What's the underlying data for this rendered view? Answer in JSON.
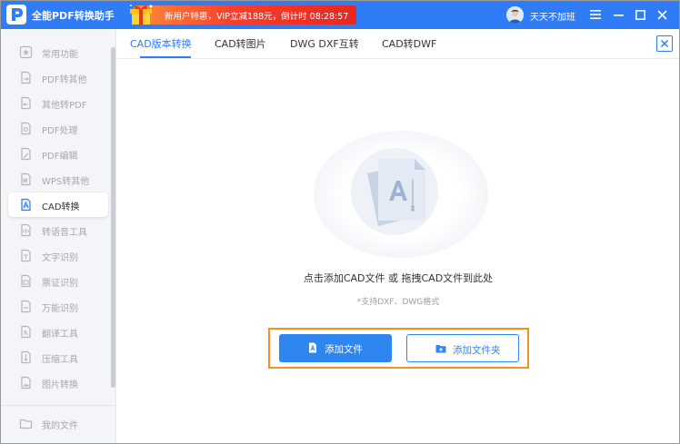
{
  "app": {
    "title": "全能PDF转换助手",
    "promo_text": "新用户特惠，VIP立减188元，倒计时 08:28:57",
    "username": "天天不加班",
    "accent_color": "#2f7cf6",
    "promo_color": "#e8261f"
  },
  "window_controls": {
    "menu_icon": "hamburger-icon",
    "minimize_icon": "minimize-icon",
    "maximize_icon": "maximize-icon",
    "close_icon": "close-icon"
  },
  "sidebar": {
    "items": [
      {
        "label": "常用功能",
        "icon": "star-icon"
      },
      {
        "label": "PDF转其他",
        "icon": "pdf-convert-icon"
      },
      {
        "label": "其他转PDF",
        "icon": "to-pdf-icon"
      },
      {
        "label": "PDF处理",
        "icon": "pdf-process-icon"
      },
      {
        "label": "PDF编辑",
        "icon": "pdf-edit-icon"
      },
      {
        "label": "WPS转其他",
        "icon": "wps-icon"
      },
      {
        "label": "CAD转换",
        "icon": "cad-icon",
        "active": true
      },
      {
        "label": "转语音工具",
        "icon": "voice-icon"
      },
      {
        "label": "文字识别",
        "icon": "ocr-icon"
      },
      {
        "label": "票证识别",
        "icon": "ticket-icon"
      },
      {
        "label": "万能识别",
        "icon": "scan-icon"
      },
      {
        "label": "翻译工具",
        "icon": "translate-icon"
      },
      {
        "label": "压缩工具",
        "icon": "compress-icon"
      },
      {
        "label": "图片转换",
        "icon": "image-icon"
      }
    ],
    "my_files": {
      "label": "我的文件",
      "icon": "folder-icon"
    }
  },
  "tabs": [
    {
      "label": "CAD版本转换",
      "active": true
    },
    {
      "label": "CAD转图片",
      "active": false
    },
    {
      "label": "DWG DXF互转",
      "active": false
    },
    {
      "label": "CAD转DWF",
      "active": false
    }
  ],
  "dropzone": {
    "instruction": "点击添加CAD文件 或 拖拽CAD文件到此处",
    "hint": "*支持DXF、DWG格式"
  },
  "buttons": {
    "add_file": "添加文件",
    "add_folder": "添加文件夹"
  }
}
